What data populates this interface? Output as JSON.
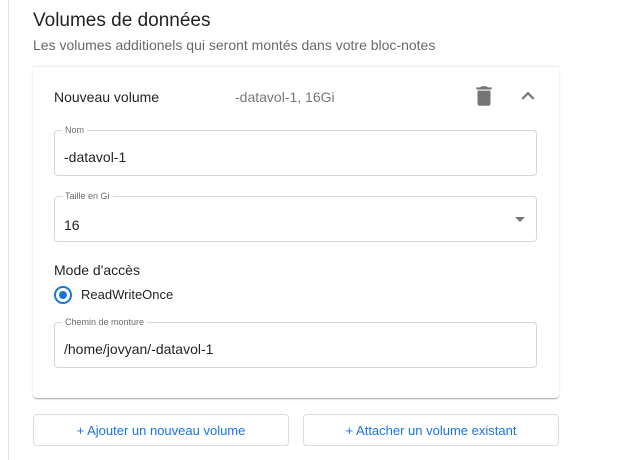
{
  "section": {
    "title": "Volumes de données",
    "subtitle": "Les volumes additionels qui seront montés dans votre bloc-notes"
  },
  "volume": {
    "title": "Nouveau volume",
    "description": "-datavol-1, 16Gi",
    "delete_icon": "trash-icon",
    "collapse_icon": "chevron-up-icon",
    "name_field": {
      "label": "Nom",
      "value": "-datavol-1"
    },
    "size_field": {
      "label": "Taille en Gi",
      "value": "16"
    },
    "access_mode": {
      "label": "Mode d'accès",
      "option": "ReadWriteOnce",
      "selected": true
    },
    "mount_field": {
      "label": "Chemin de monture",
      "value": "/home/jovyan/-datavol-1"
    }
  },
  "actions": {
    "add_new": "+ Ajouter un nouveau volume",
    "attach_existing": "+ Attacher un volume existant"
  },
  "colors": {
    "accent": "#1976d2",
    "link": "#1a73e8"
  }
}
